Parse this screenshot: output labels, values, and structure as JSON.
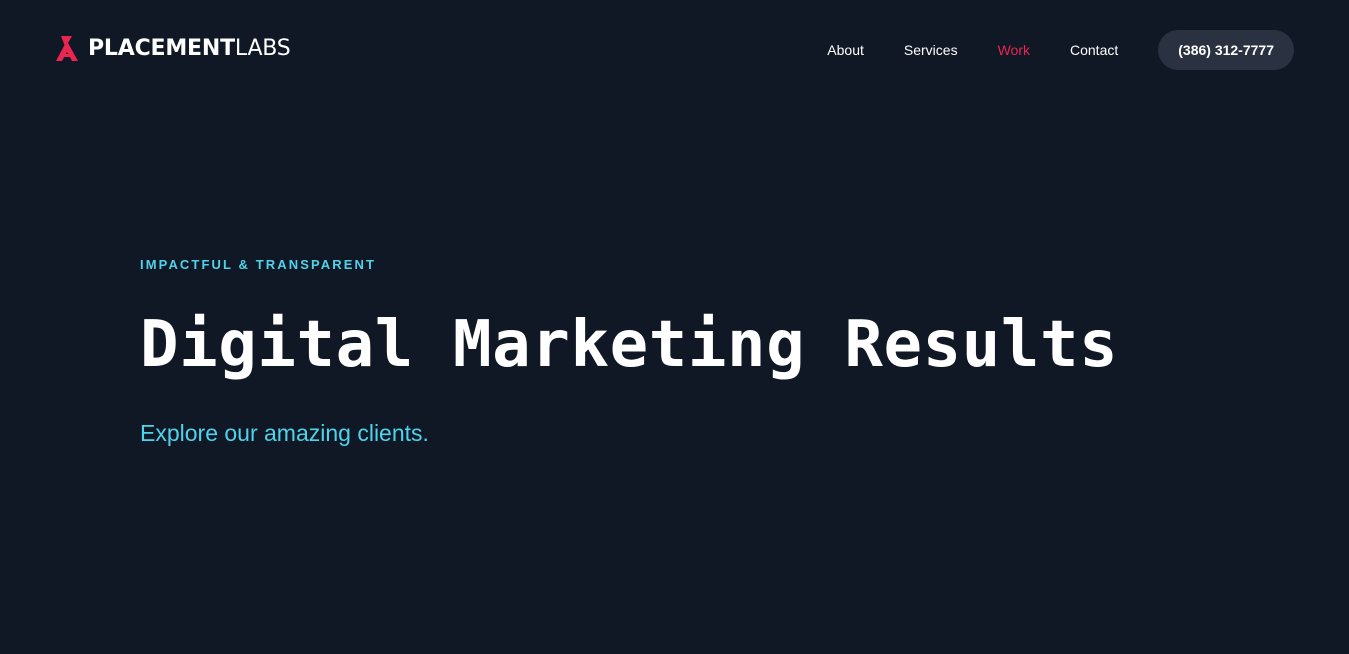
{
  "header": {
    "logo": {
      "bold_text": "PLACEMENT",
      "light_text": "LABS",
      "icon": "placement-labs-logo-mark",
      "brand_color": "#e8264f"
    },
    "nav": {
      "items": [
        {
          "label": "About"
        },
        {
          "label": "Services"
        },
        {
          "label": "Work",
          "active": true
        },
        {
          "label": "Contact"
        }
      ],
      "phone": "(386) 312-7777"
    }
  },
  "hero": {
    "eyebrow": "IMPACTFUL & TRANSPARENT",
    "headline": "Digital Marketing Results",
    "subhead": "Explore our amazing clients."
  },
  "colors": {
    "background": "#0f1824",
    "accent_cyan": "#4fd3ec",
    "accent_red": "#e8264f",
    "button_bg": "#2a3242"
  }
}
